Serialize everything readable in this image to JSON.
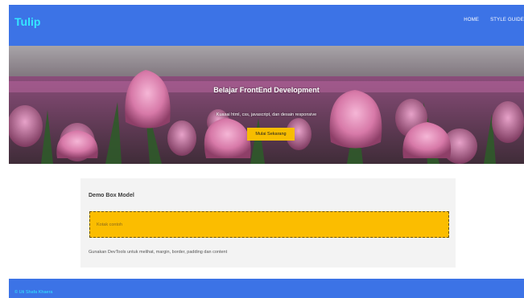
{
  "header": {
    "brand": "Tulip",
    "nav": [
      "HOME",
      "STYLE GUIDE"
    ]
  },
  "hero": {
    "title": "Belajar FrontEnd Development",
    "subtitle": "Kuasai html, css, javascript, dan desain responsive",
    "button_label": "Mulai Sekarang",
    "image_icon": "tulip-field-image"
  },
  "box": {
    "title": "Demo Box Model",
    "sample_label": "Kotak contoh",
    "description": "Gunakan DevTools untuk melihat, margin, border, padding dan content"
  },
  "footer": {
    "text": "© Uti Shafa Khaera"
  },
  "colors": {
    "primary": "#3c73e6",
    "brand_text": "#35e6ff",
    "accent": "#f7bd00",
    "panel": "#f3f3f3"
  }
}
